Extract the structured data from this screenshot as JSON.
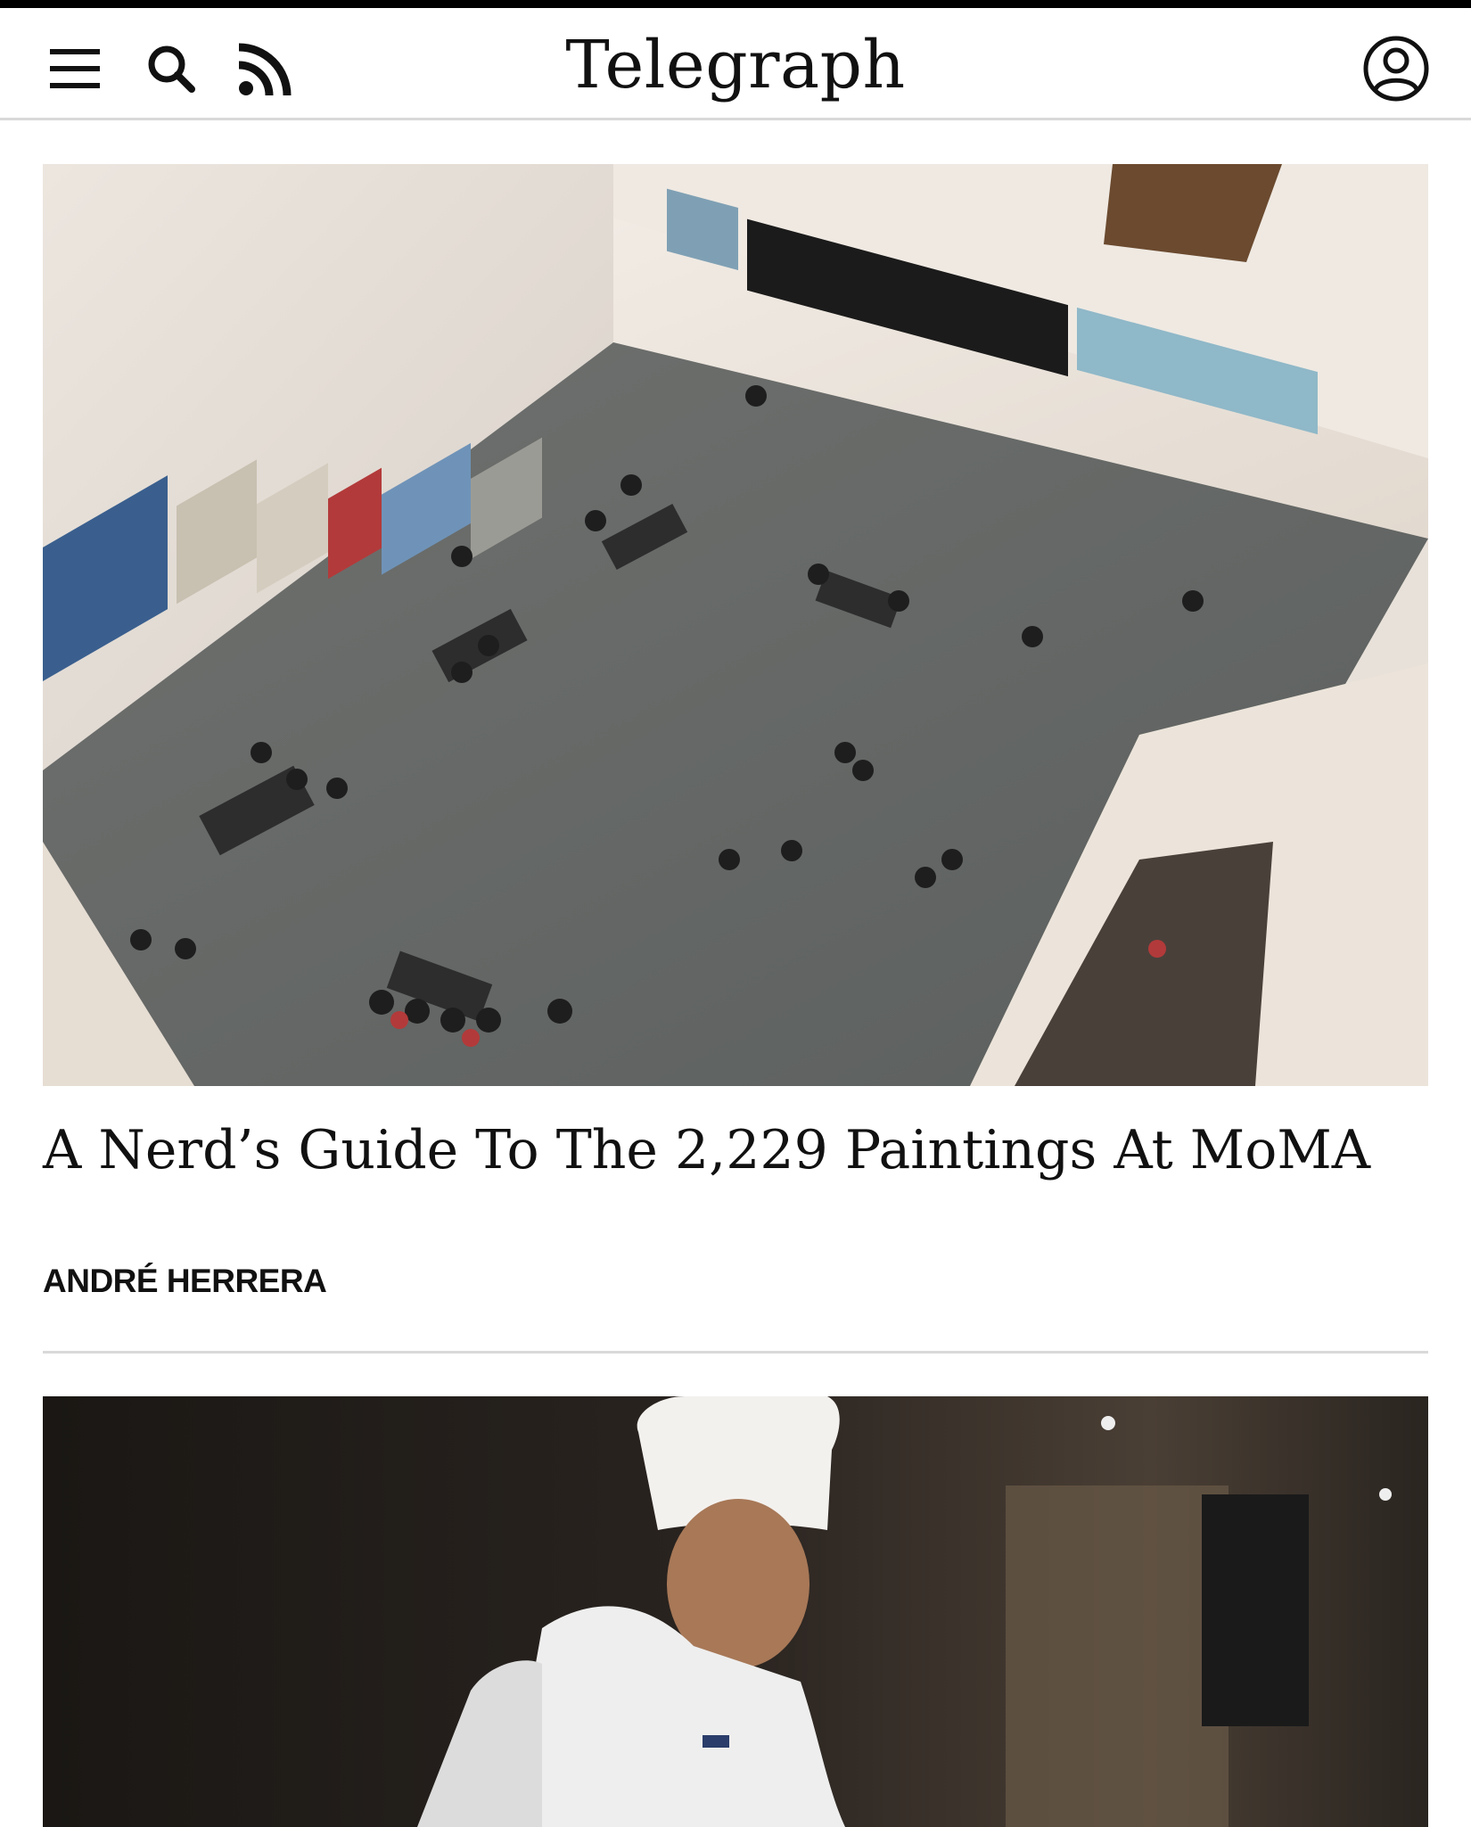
{
  "header": {
    "brand": "Telegraph",
    "menu_icon": "menu-icon",
    "search_icon": "search-icon",
    "rss_icon": "rss-icon",
    "account_icon": "account-icon"
  },
  "articles": [
    {
      "image": "Overhead view of a museum gallery with visitors and wall paintings",
      "headline": "A Nerd’s Guide To The 2,229 Paintings At MoMA",
      "author": "ANDRÉ HERRERA"
    },
    {
      "image": "Sushi chef in white hat preparing food in a dim restaurant"
    }
  ],
  "colors": {
    "top_bar": "#000000",
    "divider": "#d9d9d9",
    "text": "#111111"
  }
}
